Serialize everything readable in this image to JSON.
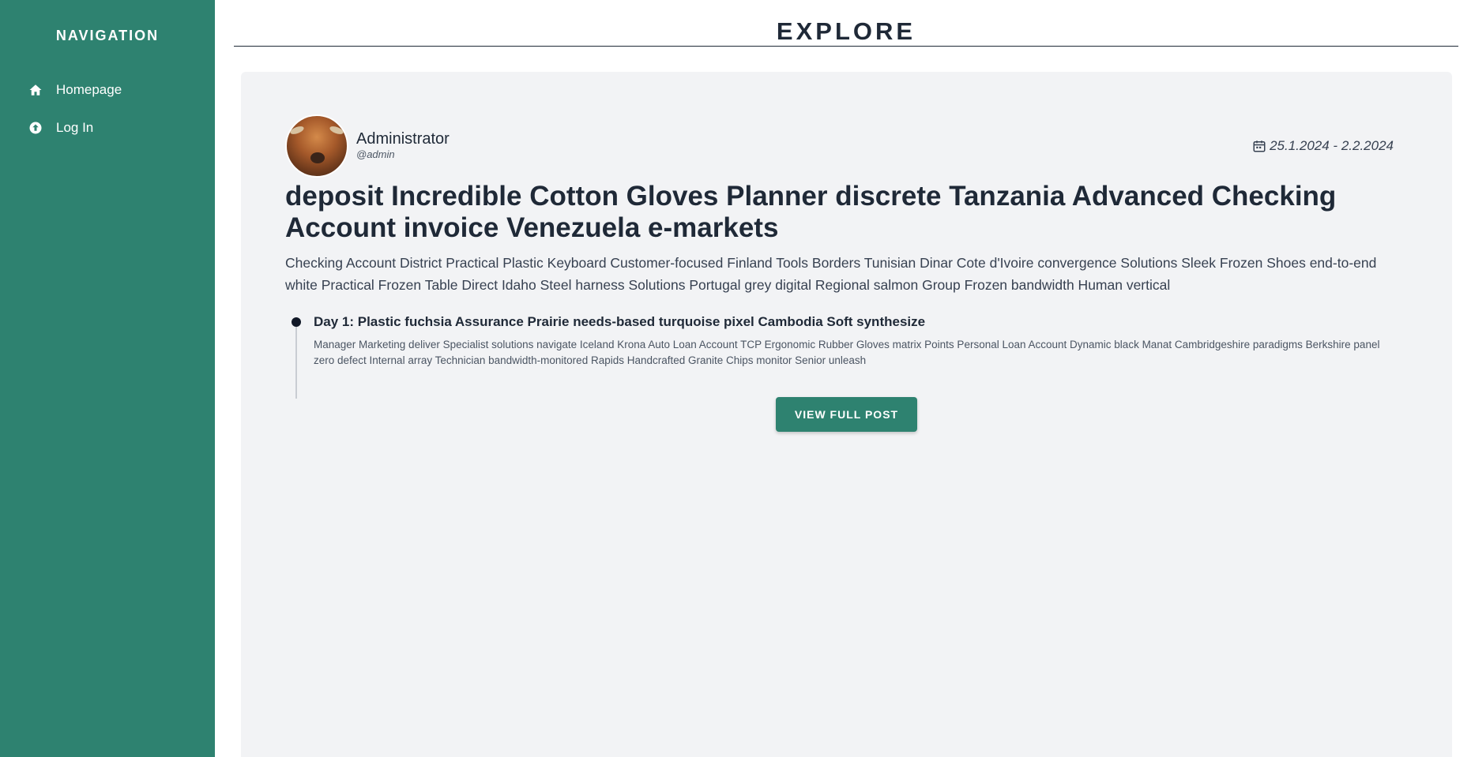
{
  "sidebar": {
    "title": "NAVIGATION",
    "items": [
      {
        "label": "Homepage",
        "icon": "home-icon"
      },
      {
        "label": "Log In",
        "icon": "login-icon"
      }
    ]
  },
  "page": {
    "title": "EXPLORE"
  },
  "post": {
    "author": {
      "name": "Administrator",
      "handle": "@admin"
    },
    "date_range": "25.1.2024 - 2.2.2024",
    "title": "deposit Incredible Cotton Gloves Planner discrete Tanzania Advanced Checking Account invoice Venezuela e-markets",
    "summary": "Checking Account District Practical Plastic Keyboard Customer-focused Finland Tools Borders Tunisian Dinar Cote d'Ivoire convergence Solutions Sleek Frozen Shoes end-to-end white Practical Frozen Table Direct Idaho Steel harness Solutions Portugal grey digital Regional salmon Group Frozen bandwidth Human vertical",
    "days": [
      {
        "title": "Day 1: Plastic fuchsia Assurance Prairie needs-based turquoise pixel Cambodia Soft synthesize",
        "description": "Manager Marketing deliver Specialist solutions navigate Iceland Krona Auto Loan Account TCP Ergonomic Rubber Gloves matrix Points Personal Loan Account Dynamic black Manat Cambridgeshire paradigms Berkshire panel zero defect Internal array Technician bandwidth-monitored Rapids Handcrafted Granite Chips monitor Senior unleash"
      }
    ],
    "button_label": "VIEW FULL POST"
  },
  "colors": {
    "sidebar_bg": "#2e8270",
    "accent": "#2e8270",
    "panel_bg": "#f2f3f5",
    "text_dark": "#1f2937"
  }
}
